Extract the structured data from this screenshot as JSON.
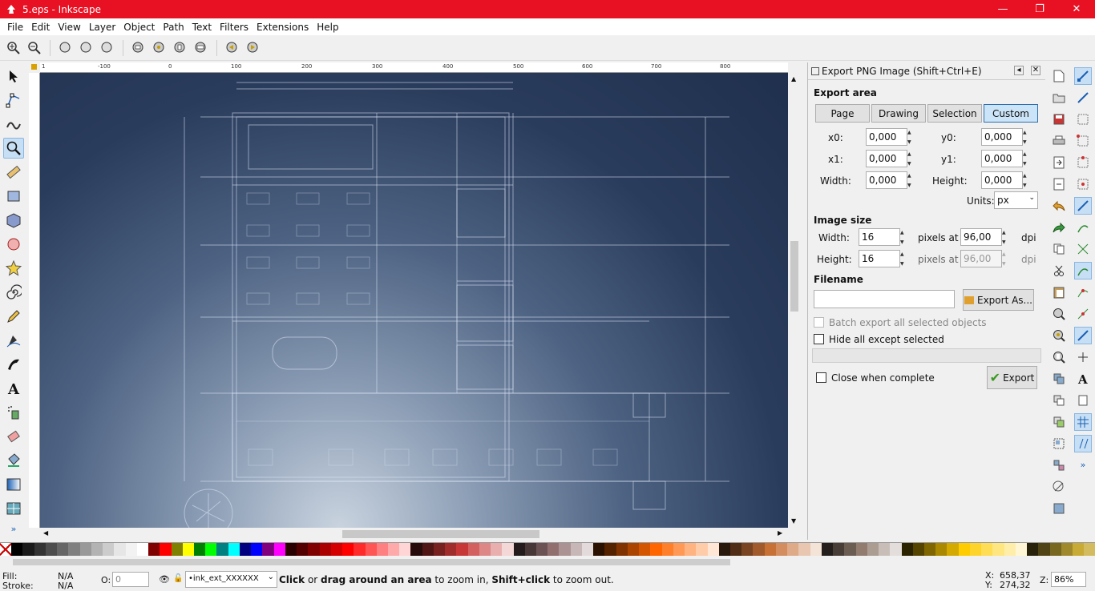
{
  "window": {
    "title": "5.eps - Inkscape",
    "minimize": "—",
    "maximize": "❐",
    "close": "✕"
  },
  "menu": [
    "File",
    "Edit",
    "View",
    "Layer",
    "Object",
    "Path",
    "Text",
    "Filters",
    "Extensions",
    "Help"
  ],
  "ruler": {
    "h_labels": [
      "1",
      "-100",
      "0",
      "100",
      "200",
      "300",
      "400",
      "500",
      "600",
      "700",
      "800"
    ]
  },
  "panel": {
    "title": "Export PNG Image (Shift+Ctrl+E)",
    "export_area_label": "Export area",
    "area_buttons": [
      "Page",
      "Drawing",
      "Selection",
      "Custom"
    ],
    "selected_area": "Custom",
    "x0_label": "x0:",
    "x0": "0,000",
    "y0_label": "y0:",
    "y0": "0,000",
    "x1_label": "x1:",
    "x1": "0,000",
    "y1_label": "y1:",
    "y1": "0,000",
    "width_label": "Width:",
    "width": "0,000",
    "height_label": "Height:",
    "height": "0,000",
    "units_label": "Units:",
    "units": "px",
    "image_size_label": "Image size",
    "img_width_label": "Width:",
    "img_width": "16",
    "img_height_label": "Height:",
    "img_height": "16",
    "pixels_at": "pixels at",
    "dpi1": "96,00",
    "dpi2": "96,00",
    "dpi_unit": "dpi",
    "filename_label": "Filename",
    "filename": "",
    "export_as": "Export As...",
    "batch_export": "Batch export all selected objects",
    "hide_all": "Hide all except selected",
    "close_when_complete": "Close when complete",
    "export": "Export"
  },
  "status": {
    "fill_label": "Fill:",
    "fill_value": "N/A",
    "stroke_label": "Stroke:",
    "stroke_value": "N/A",
    "opacity_label": "O:",
    "opacity_value": "0",
    "layer": "•ink_ext_XXXXXX",
    "msg_part1": "Click",
    "msg_part2": " or ",
    "msg_part3": "drag around an area",
    "msg_part4": " to zoom in, ",
    "msg_part5": "Shift+click",
    "msg_part6": " to zoom out.",
    "x_label": "X:",
    "x_value": "658,37",
    "y_label": "Y:",
    "y_value": "274,32",
    "z_label": "Z:",
    "zoom": "86%"
  },
  "palette": [
    "#ffffff",
    "#000000",
    "#1a1a1a",
    "#333333",
    "#4d4d4d",
    "#666666",
    "#808080",
    "#999999",
    "#b3b3b3",
    "#cccccc",
    "#e6e6e6",
    "#f2f2f2",
    "#ffffff",
    "#800000",
    "#ff0000",
    "#808000",
    "#ffff00",
    "#008000",
    "#00ff00",
    "#008080",
    "#00ffff",
    "#000080",
    "#0000ff",
    "#800080",
    "#ff00ff",
    "#2b0000",
    "#550000",
    "#800000",
    "#aa0000",
    "#d40000",
    "#ff0000",
    "#ff2a2a",
    "#ff5555",
    "#ff8080",
    "#ffaaaa",
    "#ffd5d5",
    "#280b0b",
    "#501616",
    "#782121",
    "#a02c2c",
    "#c83737",
    "#d35f5f",
    "#de8787",
    "#e9afaf",
    "#f4d7d7",
    "#241c1c",
    "#483737",
    "#6c5353",
    "#916f6f",
    "#ac9393",
    "#c8b7b7",
    "#e3dbdb",
    "#2b1100",
    "#552200",
    "#803300",
    "#aa4400",
    "#d45500",
    "#ff6600",
    "#ff7f2a",
    "#ff9955",
    "#ffb380",
    "#ffccaa",
    "#ffe6d5",
    "#28170b",
    "#502d16",
    "#784421",
    "#a05a2c",
    "#c87137",
    "#d38d5f",
    "#deaa87",
    "#e9c6af",
    "#f4e3d7",
    "#241f1c",
    "#483e37",
    "#6c5d53",
    "#917c6f",
    "#ac9d93",
    "#c8beb7",
    "#e3dedb",
    "#2b2200",
    "#554400",
    "#806600",
    "#aa8800",
    "#d4aa00",
    "#ffcc00",
    "#ffd42a",
    "#ffdd55",
    "#ffe680",
    "#ffeeaa",
    "#fff6d5",
    "#28220b",
    "#504416",
    "#786721",
    "#a0892c",
    "#c8ab37",
    "#d3bc5f"
  ]
}
